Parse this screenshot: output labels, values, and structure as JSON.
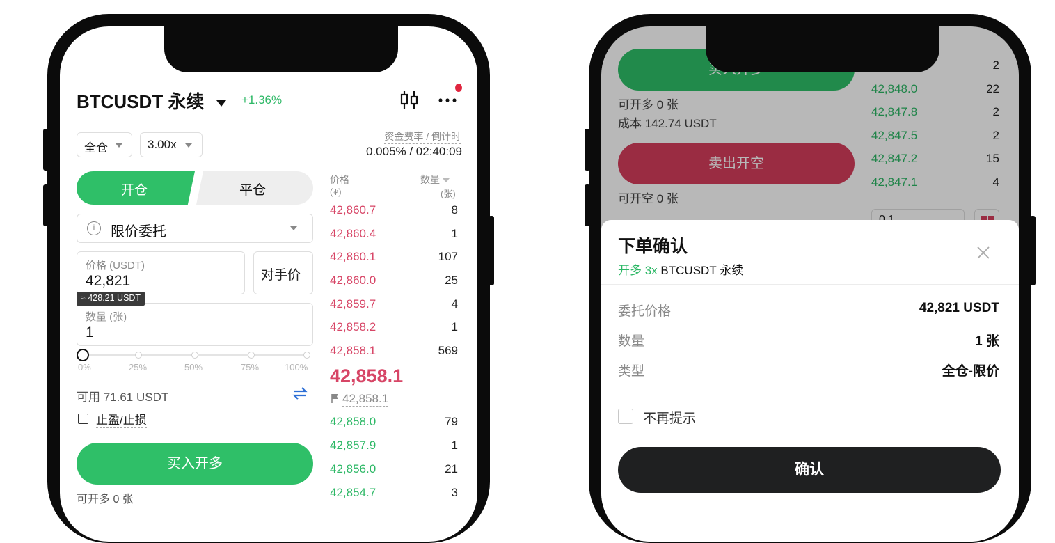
{
  "left": {
    "symbol": "BTCUSDT 永续",
    "change": "+1.36%",
    "margin_mode": "全仓",
    "leverage": "3.00x",
    "funding_label": "资金费率 / 倒计时",
    "funding_value": "0.005% / 02:40:09",
    "tab_open": "开仓",
    "tab_close": "平仓",
    "order_type": "限价委托",
    "price_label": "价格 (USDT)",
    "price_value": "42,821",
    "counter_price": "对手价",
    "approx": "≈ 428.21 USDT",
    "qty_label": "数量 (张)",
    "qty_value": "1",
    "slider_marks": [
      "0%",
      "25%",
      "50%",
      "75%",
      "100%"
    ],
    "slider_value": 0,
    "available": "可用 71.61 USDT",
    "tpsl": "止盈/止损",
    "buy_button": "买入开多",
    "can_open_long": "可开多 0 张",
    "ob_price_header": "价格",
    "ob_price_unit": "(₮)",
    "ob_qty_header": "数量",
    "ob_qty_unit": "(张)",
    "asks": [
      {
        "price": "42,860.7",
        "qty": "8"
      },
      {
        "price": "42,860.4",
        "qty": "1"
      },
      {
        "price": "42,860.1",
        "qty": "107"
      },
      {
        "price": "42,860.0",
        "qty": "25"
      },
      {
        "price": "42,859.7",
        "qty": "4"
      },
      {
        "price": "42,858.2",
        "qty": "1"
      },
      {
        "price": "42,858.1",
        "qty": "569"
      }
    ],
    "last_price": "42,858.1",
    "mark_price": "42,858.1",
    "bids": [
      {
        "price": "42,858.0",
        "qty": "79"
      },
      {
        "price": "42,857.9",
        "qty": "1"
      },
      {
        "price": "42,856.0",
        "qty": "21"
      },
      {
        "price": "42,854.7",
        "qty": "3"
      }
    ]
  },
  "right": {
    "bg_buy_button": "买入开多",
    "bg_can_open_long": "可开多 0 张",
    "bg_cost": "成本 142.74 USDT",
    "bg_sell_button": "卖出开空",
    "bg_can_open_short": "可开空 0 张",
    "bg_bids": [
      {
        "price": "",
        "qty": "2"
      },
      {
        "price": "42,848.0",
        "qty": "22"
      },
      {
        "price": "42,847.8",
        "qty": "2"
      },
      {
        "price": "42,847.5",
        "qty": "2"
      },
      {
        "price": "42,847.2",
        "qty": "15"
      },
      {
        "price": "42,847.1",
        "qty": "4"
      }
    ],
    "bg_depth_select": "0.1",
    "dialog_title": "下单确认",
    "dialog_subtitle_side": "开多 3x",
    "dialog_subtitle_symbol": "BTCUSDT 永续",
    "rows": [
      {
        "label": "委托价格",
        "value": "42,821 USDT"
      },
      {
        "label": "数量",
        "value": "1 张"
      },
      {
        "label": "类型",
        "value": "全仓-限价"
      }
    ],
    "dont_remind": "不再提示",
    "confirm_button": "确认"
  },
  "colors": {
    "green": "#2db866",
    "red": "#d74566",
    "buy_button": "#2fbf68",
    "sell_button": "#d63e5c",
    "confirm_button": "#1f2021"
  }
}
